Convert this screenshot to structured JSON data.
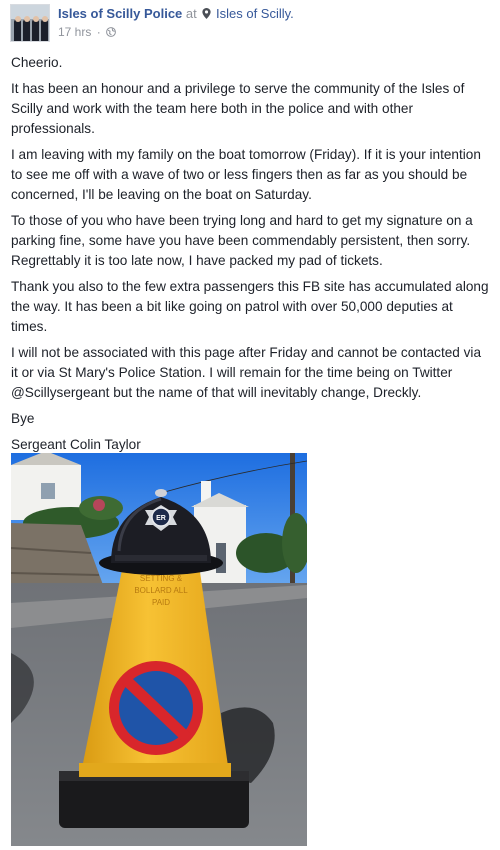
{
  "post": {
    "page_name": "Isles of Scilly Police",
    "at_word": "at",
    "location": "Isles of Scilly.",
    "time": "17 hrs",
    "separator": "·",
    "paragraphs": [
      "Cheerio.",
      "It has been an honour and a privilege to serve the community of the Isles of Scilly and work with the team here both in the police and with other professionals.",
      "I am leaving with my family on the boat tomorrow (Friday). If it is your intention to see me off with a wave of two or less fingers then as far as you should be concerned, I'll be leaving on the boat on Saturday.",
      "To those of you who have been trying long and hard to get my signature on a parking fine, some have you have been commendably persistent, then sorry. Regrettably it is too late now, I have packed my pad of tickets.",
      "Thank you also to the few extra passengers this FB site has accumulated along the way. It has been a bit like going on patrol with over 50,000 deputies at times.",
      "I will not be associated with this page after Friday and cannot be contacted via it or via St Mary's Police Station. I will remain for the time being on Twitter @Scillysergeant but the name of that will inevitably change, Dreckly.",
      "Bye",
      "Sergeant Colin Taylor"
    ],
    "photo": {
      "helmet_badge": "ER",
      "cone_label": "SETTING & BOLLARD ALL PAID"
    }
  },
  "icons": {
    "place": "map-pin-icon",
    "audience": "globe-icon"
  },
  "colors": {
    "link": "#365899",
    "meta": "#90949c",
    "text": "#1d2129",
    "cone": "#f2b51f",
    "no_parking_ring": "#d8262b",
    "no_parking_fill": "#1f54a8"
  }
}
